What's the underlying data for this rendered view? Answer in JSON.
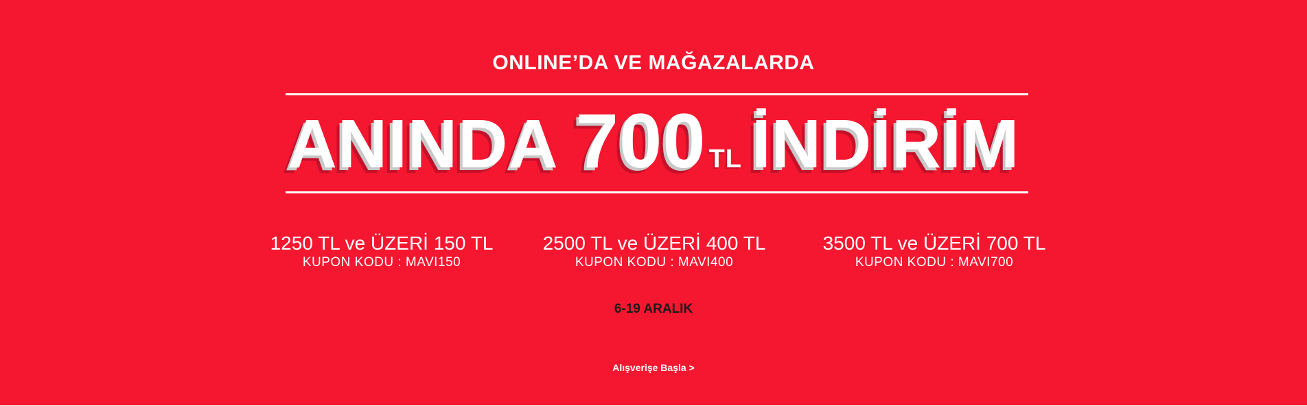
{
  "banner": {
    "background_color": "#f5162f",
    "kicker": "ONLINE’DA VE MAĞAZALARDA",
    "headline": {
      "part1": "ANINDA",
      "amount": "700",
      "unit": "TL",
      "part2": "İNDİRİM"
    },
    "offers": [
      {
        "title": "1250 TL ve ÜZERİ 150 TL",
        "code": "KUPON KODU : MAVI150"
      },
      {
        "title": "2500 TL ve ÜZERİ 400 TL",
        "code": "KUPON KODU : MAVI400"
      },
      {
        "title": "3500 TL ve ÜZERİ 700 TL",
        "code": "KUPON KODU : MAVI700"
      }
    ],
    "dates": "6-19 ARALIK",
    "cta_label": "Alışverişe Başla >"
  }
}
